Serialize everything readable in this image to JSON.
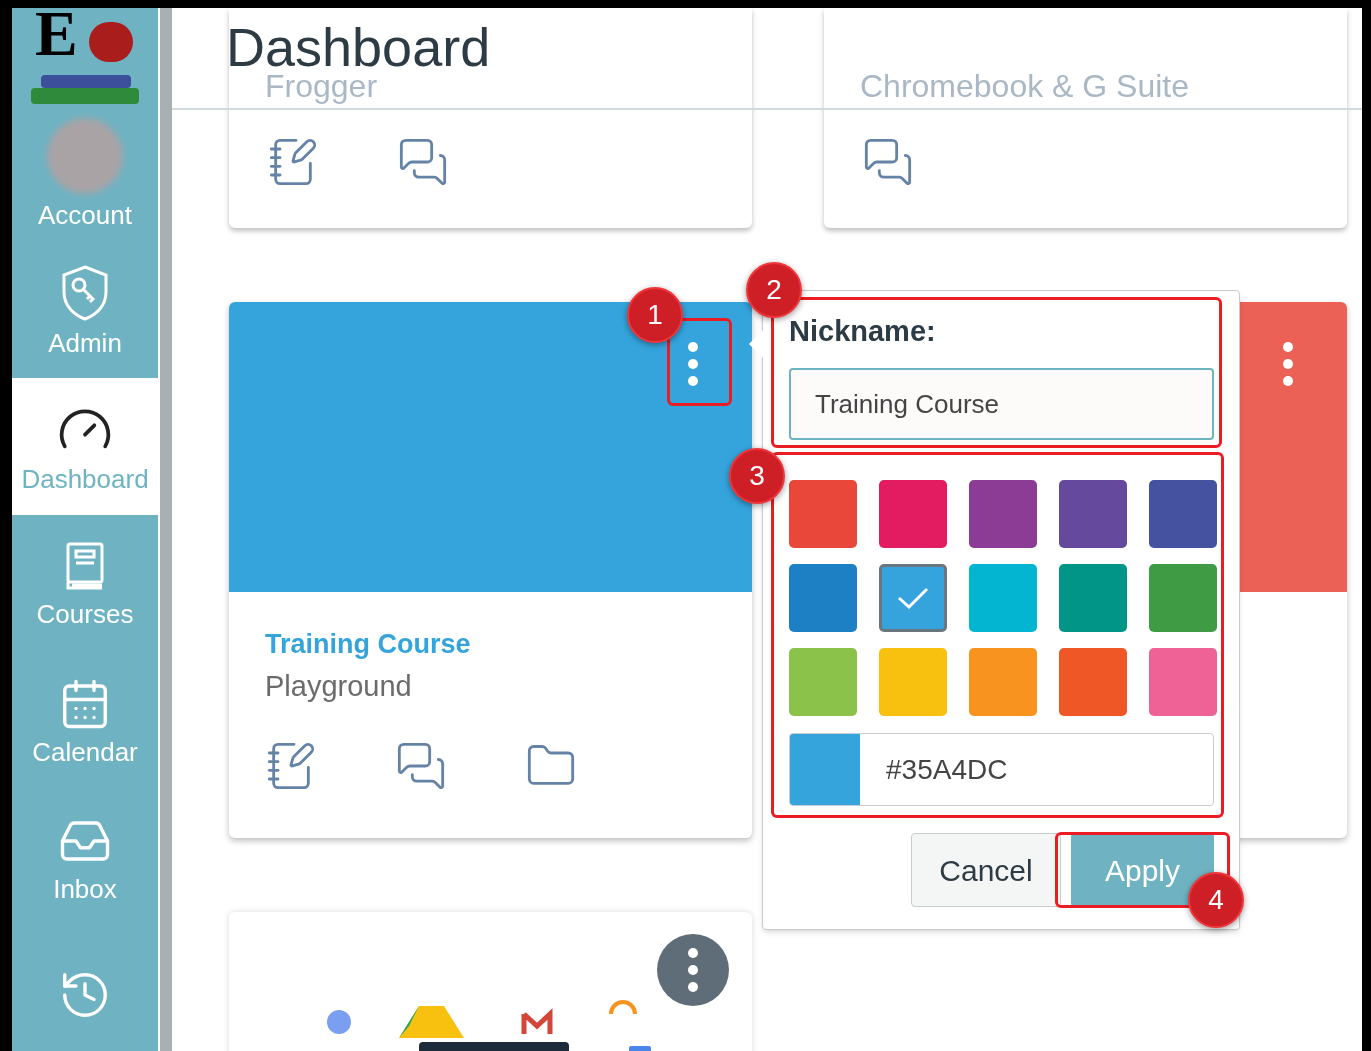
{
  "logo": {
    "letter": "E"
  },
  "sidebar": {
    "items": [
      {
        "kind": "avatar",
        "label": "Account",
        "selected": false
      },
      {
        "kind": "admin",
        "label": "Admin",
        "selected": false
      },
      {
        "kind": "dashboard",
        "label": "Dashboard",
        "selected": true
      },
      {
        "kind": "courses",
        "label": "Courses",
        "selected": false
      },
      {
        "kind": "calendar",
        "label": "Calendar",
        "selected": false
      },
      {
        "kind": "inbox",
        "label": "Inbox",
        "selected": false
      },
      {
        "kind": "history",
        "selected": false
      }
    ]
  },
  "page_title": "Dashboard",
  "cards": [
    {
      "kind": "cut",
      "title": "Frogger",
      "faded": true,
      "actions": [
        {
          "kind": "assignments"
        },
        {
          "kind": "discussions"
        }
      ]
    },
    {
      "kind": "cut",
      "title": "Chromebook & G Suite",
      "faded": true,
      "actions": [
        {
          "kind": "discussions"
        }
      ]
    },
    {
      "kind": "hero",
      "title": "Training Course",
      "subtitle": "Playground",
      "color": "#35a4dc",
      "actions": [
        {
          "kind": "assignments"
        },
        {
          "kind": "discussions"
        },
        {
          "kind": "files"
        }
      ]
    },
    {
      "kind": "hero",
      "color": "#ec6156"
    },
    {
      "kind": "image"
    }
  ],
  "popover": {
    "label": "Nickname:",
    "value": "Training Course",
    "swatches": [
      {
        "color": "#e8473a",
        "selected": false
      },
      {
        "color": "#e31c61",
        "selected": false
      },
      {
        "color": "#8d3c96",
        "selected": false
      },
      {
        "color": "#65499d",
        "selected": false
      },
      {
        "color": "#4452a0",
        "selected": false
      },
      {
        "color": "#1e80c4",
        "selected": false
      },
      {
        "color": "#35a4dc",
        "selected": true
      },
      {
        "color": "#03b5d0",
        "selected": false
      },
      {
        "color": "#009587",
        "selected": false
      },
      {
        "color": "#3f9b44",
        "selected": false
      },
      {
        "color": "#8bc34a",
        "selected": false
      },
      {
        "color": "#f8c10f",
        "selected": false
      },
      {
        "color": "#f7931e",
        "selected": false
      },
      {
        "color": "#ef5727",
        "selected": false
      },
      {
        "color": "#ee6296",
        "selected": false
      }
    ],
    "hex": "#35A4DC",
    "buttons": [
      {
        "label": "Cancel",
        "kind": "secondary"
      },
      {
        "label": "Apply",
        "kind": "primary"
      }
    ]
  },
  "annotations": [
    {
      "number": "1"
    },
    {
      "number": "2"
    },
    {
      "number": "3"
    },
    {
      "number": "4"
    }
  ]
}
